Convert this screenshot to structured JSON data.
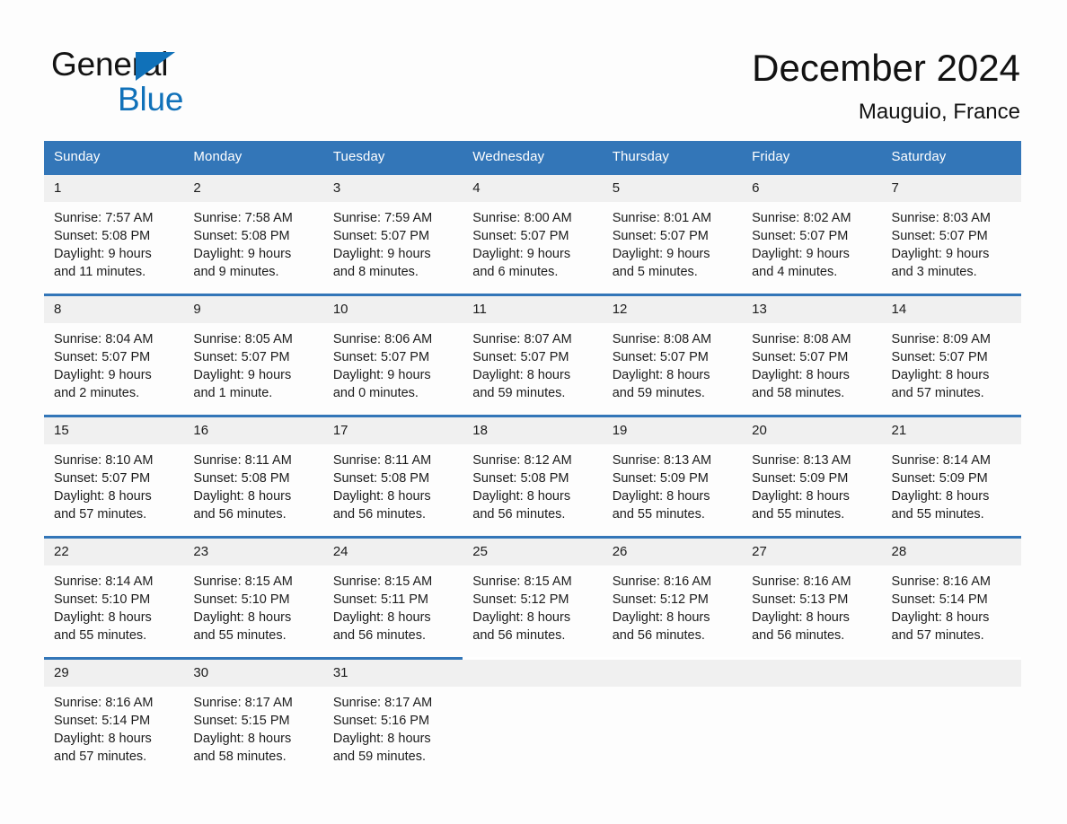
{
  "brand": {
    "name_part1": "General",
    "name_part2": "Blue"
  },
  "header": {
    "month_title": "December 2024",
    "location": "Mauguio, France"
  },
  "colors": {
    "header_blue": "#3376b8",
    "brand_blue": "#1071b9",
    "daynum_band": "#f0f0f0",
    "page_background": "#fdfdfd"
  },
  "weekday_headers": [
    "Sunday",
    "Monday",
    "Tuesday",
    "Wednesday",
    "Thursday",
    "Friday",
    "Saturday"
  ],
  "weeks": [
    [
      {
        "day": "1",
        "sunrise": "Sunrise: 7:57 AM",
        "sunset": "Sunset: 5:08 PM",
        "daylight_line1": "Daylight: 9 hours",
        "daylight_line2": "and 11 minutes."
      },
      {
        "day": "2",
        "sunrise": "Sunrise: 7:58 AM",
        "sunset": "Sunset: 5:08 PM",
        "daylight_line1": "Daylight: 9 hours",
        "daylight_line2": "and 9 minutes."
      },
      {
        "day": "3",
        "sunrise": "Sunrise: 7:59 AM",
        "sunset": "Sunset: 5:07 PM",
        "daylight_line1": "Daylight: 9 hours",
        "daylight_line2": "and 8 minutes."
      },
      {
        "day": "4",
        "sunrise": "Sunrise: 8:00 AM",
        "sunset": "Sunset: 5:07 PM",
        "daylight_line1": "Daylight: 9 hours",
        "daylight_line2": "and 6 minutes."
      },
      {
        "day": "5",
        "sunrise": "Sunrise: 8:01 AM",
        "sunset": "Sunset: 5:07 PM",
        "daylight_line1": "Daylight: 9 hours",
        "daylight_line2": "and 5 minutes."
      },
      {
        "day": "6",
        "sunrise": "Sunrise: 8:02 AM",
        "sunset": "Sunset: 5:07 PM",
        "daylight_line1": "Daylight: 9 hours",
        "daylight_line2": "and 4 minutes."
      },
      {
        "day": "7",
        "sunrise": "Sunrise: 8:03 AM",
        "sunset": "Sunset: 5:07 PM",
        "daylight_line1": "Daylight: 9 hours",
        "daylight_line2": "and 3 minutes."
      }
    ],
    [
      {
        "day": "8",
        "sunrise": "Sunrise: 8:04 AM",
        "sunset": "Sunset: 5:07 PM",
        "daylight_line1": "Daylight: 9 hours",
        "daylight_line2": "and 2 minutes."
      },
      {
        "day": "9",
        "sunrise": "Sunrise: 8:05 AM",
        "sunset": "Sunset: 5:07 PM",
        "daylight_line1": "Daylight: 9 hours",
        "daylight_line2": "and 1 minute."
      },
      {
        "day": "10",
        "sunrise": "Sunrise: 8:06 AM",
        "sunset": "Sunset: 5:07 PM",
        "daylight_line1": "Daylight: 9 hours",
        "daylight_line2": "and 0 minutes."
      },
      {
        "day": "11",
        "sunrise": "Sunrise: 8:07 AM",
        "sunset": "Sunset: 5:07 PM",
        "daylight_line1": "Daylight: 8 hours",
        "daylight_line2": "and 59 minutes."
      },
      {
        "day": "12",
        "sunrise": "Sunrise: 8:08 AM",
        "sunset": "Sunset: 5:07 PM",
        "daylight_line1": "Daylight: 8 hours",
        "daylight_line2": "and 59 minutes."
      },
      {
        "day": "13",
        "sunrise": "Sunrise: 8:08 AM",
        "sunset": "Sunset: 5:07 PM",
        "daylight_line1": "Daylight: 8 hours",
        "daylight_line2": "and 58 minutes."
      },
      {
        "day": "14",
        "sunrise": "Sunrise: 8:09 AM",
        "sunset": "Sunset: 5:07 PM",
        "daylight_line1": "Daylight: 8 hours",
        "daylight_line2": "and 57 minutes."
      }
    ],
    [
      {
        "day": "15",
        "sunrise": "Sunrise: 8:10 AM",
        "sunset": "Sunset: 5:07 PM",
        "daylight_line1": "Daylight: 8 hours",
        "daylight_line2": "and 57 minutes."
      },
      {
        "day": "16",
        "sunrise": "Sunrise: 8:11 AM",
        "sunset": "Sunset: 5:08 PM",
        "daylight_line1": "Daylight: 8 hours",
        "daylight_line2": "and 56 minutes."
      },
      {
        "day": "17",
        "sunrise": "Sunrise: 8:11 AM",
        "sunset": "Sunset: 5:08 PM",
        "daylight_line1": "Daylight: 8 hours",
        "daylight_line2": "and 56 minutes."
      },
      {
        "day": "18",
        "sunrise": "Sunrise: 8:12 AM",
        "sunset": "Sunset: 5:08 PM",
        "daylight_line1": "Daylight: 8 hours",
        "daylight_line2": "and 56 minutes."
      },
      {
        "day": "19",
        "sunrise": "Sunrise: 8:13 AM",
        "sunset": "Sunset: 5:09 PM",
        "daylight_line1": "Daylight: 8 hours",
        "daylight_line2": "and 55 minutes."
      },
      {
        "day": "20",
        "sunrise": "Sunrise: 8:13 AM",
        "sunset": "Sunset: 5:09 PM",
        "daylight_line1": "Daylight: 8 hours",
        "daylight_line2": "and 55 minutes."
      },
      {
        "day": "21",
        "sunrise": "Sunrise: 8:14 AM",
        "sunset": "Sunset: 5:09 PM",
        "daylight_line1": "Daylight: 8 hours",
        "daylight_line2": "and 55 minutes."
      }
    ],
    [
      {
        "day": "22",
        "sunrise": "Sunrise: 8:14 AM",
        "sunset": "Sunset: 5:10 PM",
        "daylight_line1": "Daylight: 8 hours",
        "daylight_line2": "and 55 minutes."
      },
      {
        "day": "23",
        "sunrise": "Sunrise: 8:15 AM",
        "sunset": "Sunset: 5:10 PM",
        "daylight_line1": "Daylight: 8 hours",
        "daylight_line2": "and 55 minutes."
      },
      {
        "day": "24",
        "sunrise": "Sunrise: 8:15 AM",
        "sunset": "Sunset: 5:11 PM",
        "daylight_line1": "Daylight: 8 hours",
        "daylight_line2": "and 56 minutes."
      },
      {
        "day": "25",
        "sunrise": "Sunrise: 8:15 AM",
        "sunset": "Sunset: 5:12 PM",
        "daylight_line1": "Daylight: 8 hours",
        "daylight_line2": "and 56 minutes."
      },
      {
        "day": "26",
        "sunrise": "Sunrise: 8:16 AM",
        "sunset": "Sunset: 5:12 PM",
        "daylight_line1": "Daylight: 8 hours",
        "daylight_line2": "and 56 minutes."
      },
      {
        "day": "27",
        "sunrise": "Sunrise: 8:16 AM",
        "sunset": "Sunset: 5:13 PM",
        "daylight_line1": "Daylight: 8 hours",
        "daylight_line2": "and 56 minutes."
      },
      {
        "day": "28",
        "sunrise": "Sunrise: 8:16 AM",
        "sunset": "Sunset: 5:14 PM",
        "daylight_line1": "Daylight: 8 hours",
        "daylight_line2": "and 57 minutes."
      }
    ],
    [
      {
        "day": "29",
        "sunrise": "Sunrise: 8:16 AM",
        "sunset": "Sunset: 5:14 PM",
        "daylight_line1": "Daylight: 8 hours",
        "daylight_line2": "and 57 minutes."
      },
      {
        "day": "30",
        "sunrise": "Sunrise: 8:17 AM",
        "sunset": "Sunset: 5:15 PM",
        "daylight_line1": "Daylight: 8 hours",
        "daylight_line2": "and 58 minutes."
      },
      {
        "day": "31",
        "sunrise": "Sunrise: 8:17 AM",
        "sunset": "Sunset: 5:16 PM",
        "daylight_line1": "Daylight: 8 hours",
        "daylight_line2": "and 59 minutes."
      },
      {
        "day": "",
        "sunrise": "",
        "sunset": "",
        "daylight_line1": "",
        "daylight_line2": ""
      },
      {
        "day": "",
        "sunrise": "",
        "sunset": "",
        "daylight_line1": "",
        "daylight_line2": ""
      },
      {
        "day": "",
        "sunrise": "",
        "sunset": "",
        "daylight_line1": "",
        "daylight_line2": ""
      },
      {
        "day": "",
        "sunrise": "",
        "sunset": "",
        "daylight_line1": "",
        "daylight_line2": ""
      }
    ]
  ]
}
